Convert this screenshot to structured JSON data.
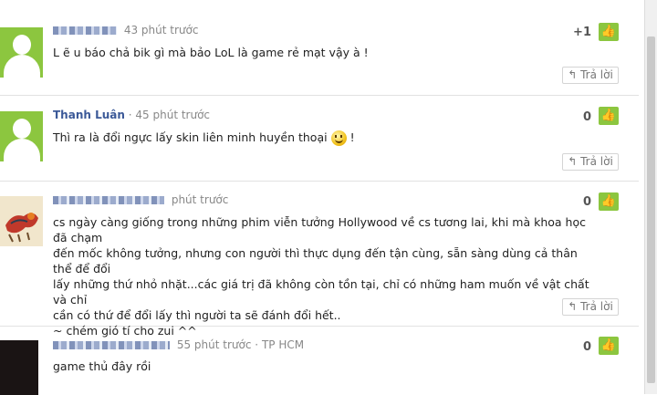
{
  "comments": [
    {
      "time": "43 phút trước",
      "text": "L ẽ u báo chả bik gì mà bảo LoL là game rẻ mạt vậy à !",
      "likes": "+1",
      "reply": "Trả lời"
    },
    {
      "name": "Thanh Luân",
      "time": "45 phút trước",
      "text": "Thì ra là đổi ngực lấy skin liên minh huyền thoại",
      "text_end": "!",
      "likes": "0",
      "reply": "Trả lời"
    },
    {
      "time": "phút trước",
      "lines": [
        "cs ngày càng giống trong những phim viễn tưởng Hollywood về cs tương lai, khi mà khoa học đã chạm",
        "đến mốc không tưởng, nhưng con người thì thực dụng đến tận cùng, sẵn sàng dùng cả thân thể để đổi",
        "lấy những thứ nhỏ nhặt...các giá trị đã không còn tồn tại, chỉ có những ham muốn về vật chất và chỉ",
        "cần có thứ để đổi lấy thì người ta sẽ đánh đổi hết..",
        "~ chém gió tí cho zui ^^"
      ],
      "likes": "0",
      "reply": "Trả lời"
    },
    {
      "time": "55 phút trước",
      "location": "TP HCM",
      "text": "game thủ đây rồi",
      "likes": "0"
    }
  ],
  "icons": {
    "like": "thumbs-up-icon",
    "reply": "reply-arrow-icon",
    "emoji": "smiley-icon"
  },
  "colors": {
    "like_green": "#8cc63f",
    "meta_gray": "#888888"
  }
}
